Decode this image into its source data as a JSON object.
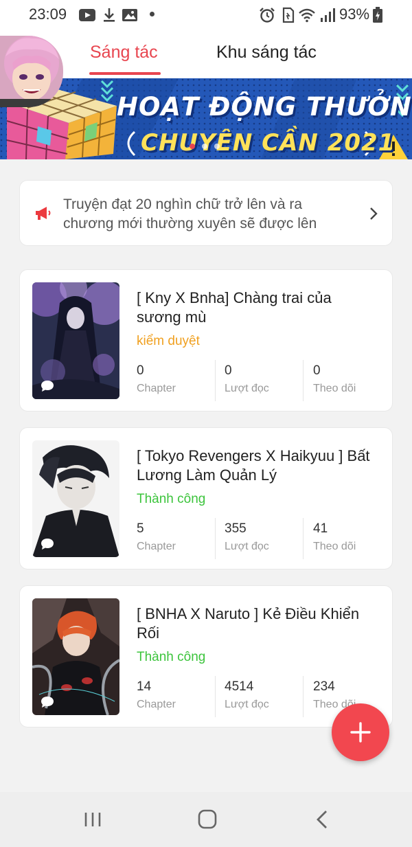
{
  "status_bar": {
    "time": "23:09",
    "battery": "93%",
    "icons": [
      "youtube-icon",
      "download-icon",
      "image-icon",
      "dot-icon",
      "alarm-icon",
      "sim-icon",
      "wifi-icon",
      "signal-icon",
      "battery-charging-icon"
    ]
  },
  "header": {
    "tabs": [
      {
        "label": "Sáng tác",
        "active": true
      },
      {
        "label": "Khu sáng tác",
        "active": false
      }
    ],
    "accent_color": "#e8454f"
  },
  "banner": {
    "line1": "HOẠT ĐỘNG THƯỞNG",
    "line2": "CHUYÊN CẦN 2021",
    "page_count": 3,
    "active_page": 0
  },
  "notice": {
    "text": "Truyện đạt 20 nghìn chữ trở lên và ra chương mới thường xuyên sẽ được lên",
    "icon": "megaphone-icon"
  },
  "stories": [
    {
      "title": "[ Kny X Bnha] Chàng trai của sương mù",
      "status": "kiểm duyệt",
      "status_color": "#f0a020",
      "stats": [
        {
          "value": "0",
          "label": "Chapter"
        },
        {
          "value": "0",
          "label": "Lượt đọc"
        },
        {
          "value": "0",
          "label": "Theo dõi"
        }
      ]
    },
    {
      "title": "[ Tokyo Revengers X Haikyuu ] Bất Lương Làm Quản Lý",
      "status": "Thành công",
      "status_color": "#3cc43c",
      "stats": [
        {
          "value": "5",
          "label": "Chapter"
        },
        {
          "value": "355",
          "label": "Lượt đọc"
        },
        {
          "value": "41",
          "label": "Theo dõi"
        }
      ]
    },
    {
      "title": "[ BNHA X Naruto ] Kẻ Điều Khiển Rối",
      "status": "Thành công",
      "status_color": "#3cc43c",
      "stats": [
        {
          "value": "14",
          "label": "Chapter"
        },
        {
          "value": "4514",
          "label": "Lượt đọc"
        },
        {
          "value": "234",
          "label": "Theo dõi"
        }
      ]
    }
  ],
  "fab": {
    "icon": "plus-icon",
    "color": "#f2474f"
  },
  "nav": {
    "icons": [
      "recent-apps-icon",
      "home-icon",
      "back-icon"
    ]
  }
}
